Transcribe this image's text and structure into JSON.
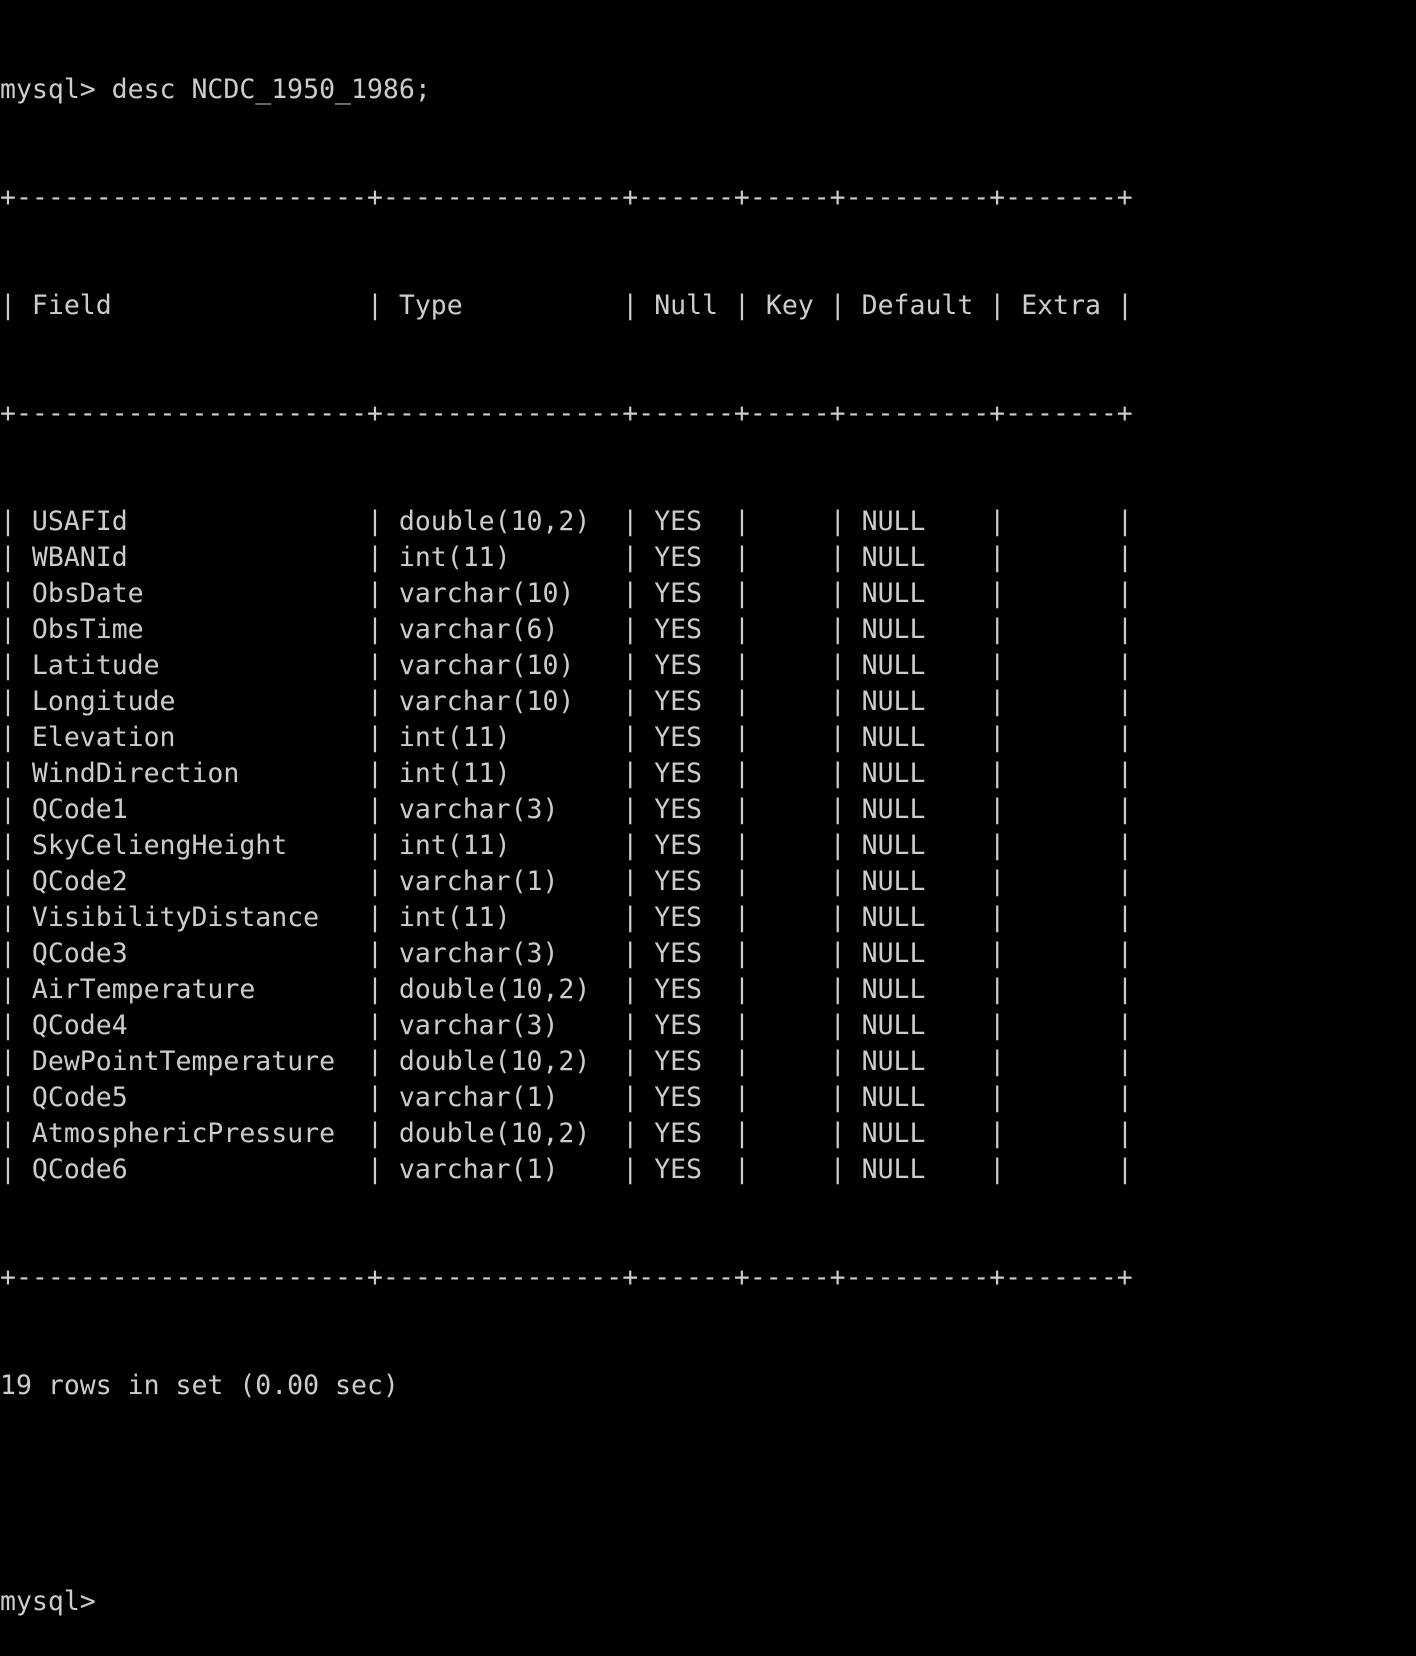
{
  "command_line": "mysql> desc NCDC_1950_1986;",
  "border": "+----------------------+---------------+------+-----+---------+-------+",
  "header": [
    "Field",
    "Type",
    "Null",
    "Key",
    "Default",
    "Extra"
  ],
  "rows": [
    [
      "USAFId",
      "double(10,2)",
      "YES",
      "",
      "NULL",
      ""
    ],
    [
      "WBANId",
      "int(11)",
      "YES",
      "",
      "NULL",
      ""
    ],
    [
      "ObsDate",
      "varchar(10)",
      "YES",
      "",
      "NULL",
      ""
    ],
    [
      "ObsTime",
      "varchar(6)",
      "YES",
      "",
      "NULL",
      ""
    ],
    [
      "Latitude",
      "varchar(10)",
      "YES",
      "",
      "NULL",
      ""
    ],
    [
      "Longitude",
      "varchar(10)",
      "YES",
      "",
      "NULL",
      ""
    ],
    [
      "Elevation",
      "int(11)",
      "YES",
      "",
      "NULL",
      ""
    ],
    [
      "WindDirection",
      "int(11)",
      "YES",
      "",
      "NULL",
      ""
    ],
    [
      "QCode1",
      "varchar(3)",
      "YES",
      "",
      "NULL",
      ""
    ],
    [
      "SkyCeliengHeight",
      "int(11)",
      "YES",
      "",
      "NULL",
      ""
    ],
    [
      "QCode2",
      "varchar(1)",
      "YES",
      "",
      "NULL",
      ""
    ],
    [
      "VisibilityDistance",
      "int(11)",
      "YES",
      "",
      "NULL",
      ""
    ],
    [
      "QCode3",
      "varchar(3)",
      "YES",
      "",
      "NULL",
      ""
    ],
    [
      "AirTemperature",
      "double(10,2)",
      "YES",
      "",
      "NULL",
      ""
    ],
    [
      "QCode4",
      "varchar(3)",
      "YES",
      "",
      "NULL",
      ""
    ],
    [
      "DewPointTemperature",
      "double(10,2)",
      "YES",
      "",
      "NULL",
      ""
    ],
    [
      "QCode5",
      "varchar(1)",
      "YES",
      "",
      "NULL",
      ""
    ],
    [
      "AtmosphericPressure",
      "double(10,2)",
      "YES",
      "",
      "NULL",
      ""
    ],
    [
      "QCode6",
      "varchar(1)",
      "YES",
      "",
      "NULL",
      ""
    ]
  ],
  "result_line": "19 rows in set (0.00 sec)",
  "prompt": "mysql>",
  "colors": {
    "background": "#000000",
    "text": "#cccccc"
  }
}
